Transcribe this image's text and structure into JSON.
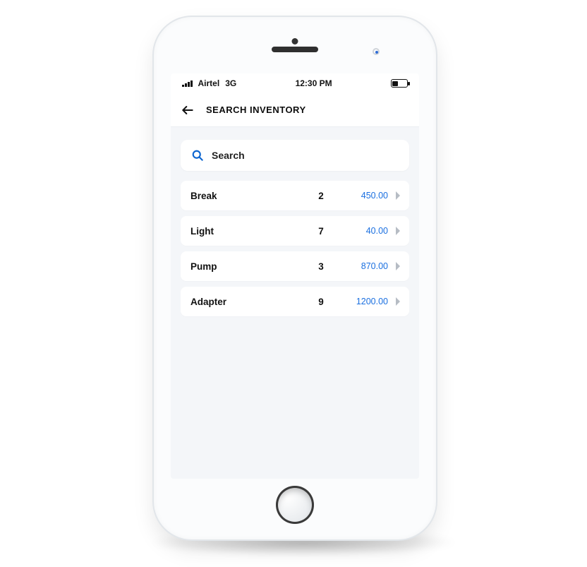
{
  "statusbar": {
    "carrier": "Airtel",
    "network": "3G",
    "time": "12:30 PM"
  },
  "appbar": {
    "title": "SEARCH INVENTORY"
  },
  "search": {
    "placeholder": "Search"
  },
  "items": [
    {
      "name": "Break",
      "qty": "2",
      "price": "450.00"
    },
    {
      "name": "Light",
      "qty": "7",
      "price": "40.00"
    },
    {
      "name": "Pump",
      "qty": "3",
      "price": "870.00"
    },
    {
      "name": "Adapter",
      "qty": "9",
      "price": "1200.00"
    }
  ]
}
